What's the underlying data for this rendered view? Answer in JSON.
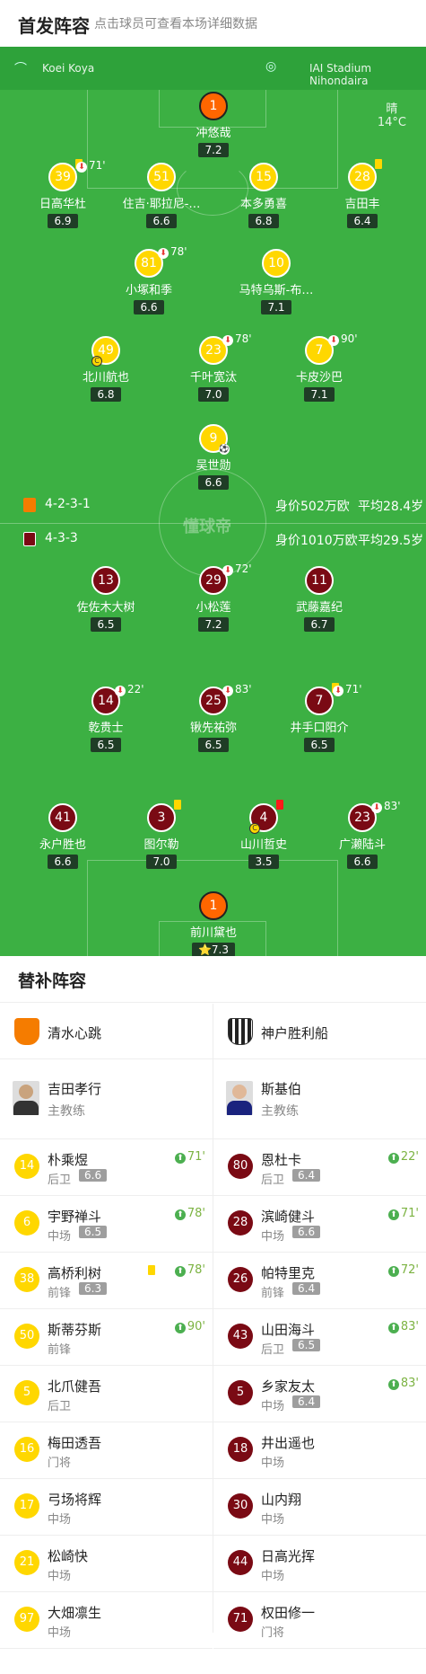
{
  "header": {
    "title": "首发阵容",
    "subtitle": "点击球员可查看本场详细数据"
  },
  "match": {
    "referee": "Koei Koya",
    "stadium": "IAI Stadium Nihondaira",
    "weather": "晴",
    "temperature": "14°C",
    "watermark": "懂球帝"
  },
  "home_team": {
    "name": "清水心跳",
    "formation": "4-2-3-1",
    "value": "身价502万欧",
    "avg_age": "平均28.4岁",
    "players": [
      {
        "num": "1",
        "name": "冲悠哉",
        "rating": "7.2",
        "kind": "gk"
      },
      {
        "num": "39",
        "name": "日高华杜",
        "rating": "6.9",
        "yellow": true,
        "sub": "71'"
      },
      {
        "num": "51",
        "name": "住吉·耶拉尼-…",
        "rating": "6.6"
      },
      {
        "num": "15",
        "name": "本多勇喜",
        "rating": "6.8"
      },
      {
        "num": "28",
        "name": "吉田丰",
        "rating": "6.4",
        "yellow": true
      },
      {
        "num": "81",
        "name": "小塚和季",
        "rating": "6.6",
        "sub": "78'"
      },
      {
        "num": "10",
        "name": "马特乌斯-布…",
        "rating": "7.1"
      },
      {
        "num": "49",
        "name": "北川航也",
        "rating": "6.8",
        "captain": true
      },
      {
        "num": "23",
        "name": "千叶宽汰",
        "rating": "7.0",
        "sub": "78'"
      },
      {
        "num": "7",
        "name": "卡皮沙巴",
        "rating": "7.1",
        "sub": "90'"
      },
      {
        "num": "9",
        "name": "吴世勋",
        "rating": "6.6",
        "goal": true
      }
    ]
  },
  "away_team": {
    "name": "神户胜利船",
    "formation": "4-3-3",
    "value": "身价1010万欧",
    "avg_age": "平均29.5岁",
    "players": [
      {
        "num": "13",
        "name": "佐佐木大树",
        "rating": "6.5"
      },
      {
        "num": "29",
        "name": "小松莲",
        "rating": "7.2",
        "sub": "72'"
      },
      {
        "num": "11",
        "name": "武藤嘉纪",
        "rating": "6.7"
      },
      {
        "num": "14",
        "name": "乾贵士",
        "rating": "6.5",
        "sub": "22'"
      },
      {
        "num": "25",
        "name": "锹先祐弥",
        "rating": "6.5",
        "sub": "83'"
      },
      {
        "num": "7",
        "name": "井手口阳介",
        "rating": "6.5",
        "yellow": true,
        "sub": "71'"
      },
      {
        "num": "41",
        "name": "永户胜也",
        "rating": "6.6"
      },
      {
        "num": "3",
        "name": "图尔勒",
        "rating": "7.0",
        "yellow": true
      },
      {
        "num": "4",
        "name": "山川哲史",
        "rating": "3.5",
        "red": true,
        "captain": true
      },
      {
        "num": "23",
        "name": "广濑陆斗",
        "rating": "6.6",
        "sub": "83'"
      },
      {
        "num": "1",
        "name": "前川黛也",
        "rating": "7.3",
        "kind": "gk",
        "star": "⭐"
      }
    ]
  },
  "bench": {
    "title": "替补阵容",
    "home": {
      "team": "清水心跳",
      "coach": "吉田孝行",
      "coach_role": "主教练",
      "players": [
        {
          "num": "14",
          "name": "朴乘煜",
          "pos": "后卫",
          "rating": "6.6",
          "min": "71'"
        },
        {
          "num": "6",
          "name": "宇野禅斗",
          "pos": "中场",
          "rating": "6.5",
          "min": "78'"
        },
        {
          "num": "38",
          "name": "高桥利树",
          "pos": "前锋",
          "rating": "6.3",
          "min": "78'",
          "yellow": true
        },
        {
          "num": "50",
          "name": "斯蒂芬斯",
          "pos": "前锋",
          "min": "90'"
        },
        {
          "num": "5",
          "name": "北爪健吾",
          "pos": "后卫"
        },
        {
          "num": "16",
          "name": "梅田透吾",
          "pos": "门将"
        },
        {
          "num": "17",
          "name": "弓场将辉",
          "pos": "中场"
        },
        {
          "num": "21",
          "name": "松崎快",
          "pos": "中场"
        },
        {
          "num": "97",
          "name": "大畑凛生",
          "pos": "中场"
        }
      ]
    },
    "away": {
      "team": "神户胜利船",
      "coach": "斯基伯",
      "coach_role": "主教练",
      "players": [
        {
          "num": "80",
          "name": "恩杜卡",
          "pos": "后卫",
          "rating": "6.4",
          "min": "22'"
        },
        {
          "num": "28",
          "name": "滨崎健斗",
          "pos": "中场",
          "rating": "6.6",
          "min": "71'"
        },
        {
          "num": "26",
          "name": "帕特里克",
          "pos": "前锋",
          "rating": "6.4",
          "min": "72'"
        },
        {
          "num": "43",
          "name": "山田海斗",
          "pos": "后卫",
          "rating": "6.5",
          "min": "83'"
        },
        {
          "num": "5",
          "name": "乡家友太",
          "pos": "中场",
          "rating": "6.4",
          "min": "83'"
        },
        {
          "num": "18",
          "name": "井出遥也",
          "pos": "中场"
        },
        {
          "num": "30",
          "name": "山内翔",
          "pos": "中场"
        },
        {
          "num": "44",
          "name": "日高光挥",
          "pos": "中场"
        },
        {
          "num": "71",
          "name": "权田修一",
          "pos": "门将"
        }
      ]
    }
  },
  "colors": {
    "pitch": "#3cb043",
    "home": "#ffd700",
    "away": "#7a0a14",
    "gk_home": "#ff6600"
  }
}
